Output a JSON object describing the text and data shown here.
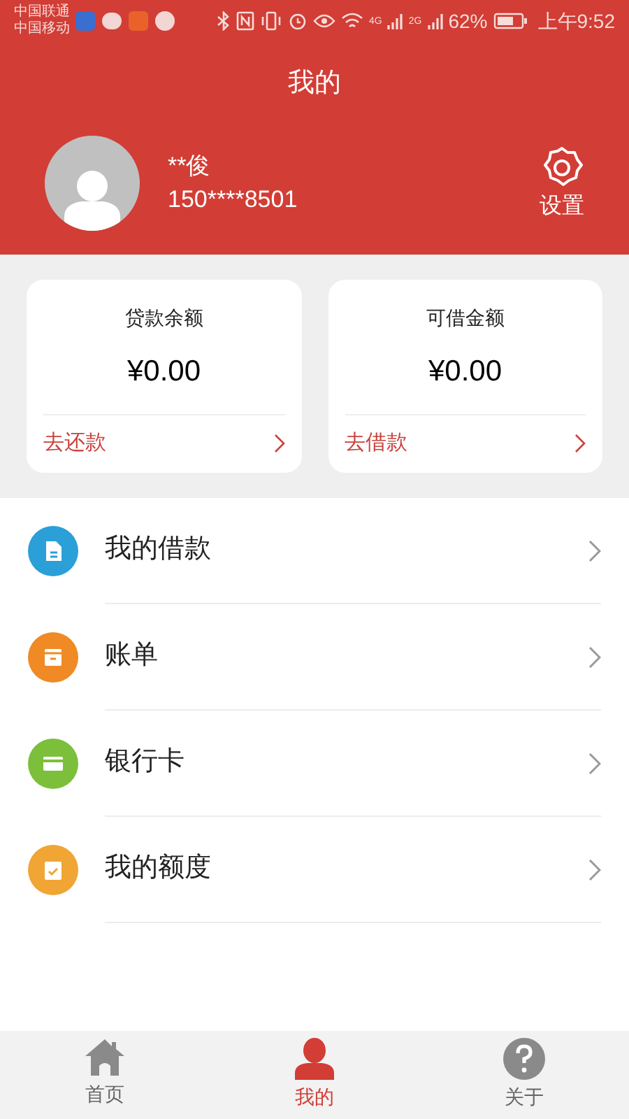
{
  "status_bar": {
    "carriers": [
      "中国联通",
      "中国移动"
    ],
    "network_1": "4G",
    "network_2": "2G",
    "battery_percent": "62%",
    "time": "上午9:52"
  },
  "header": {
    "title": "我的"
  },
  "profile": {
    "name": "**俊",
    "phone": "150****8501",
    "settings_label": "设置"
  },
  "cards": [
    {
      "title": "贷款余额",
      "amount": "¥0.00",
      "action": "去还款"
    },
    {
      "title": "可借金额",
      "amount": "¥0.00",
      "action": "去借款"
    }
  ],
  "menu": [
    {
      "label": "我的借款",
      "kind": "document",
      "color": "#2a9fd8"
    },
    {
      "label": "账单",
      "kind": "box",
      "color": "#f08a24"
    },
    {
      "label": "银行卡",
      "kind": "card",
      "color": "#7bbf3a"
    },
    {
      "label": "我的额度",
      "kind": "clipboard",
      "color": "#f0a534"
    }
  ],
  "bottom_nav": [
    {
      "label": "首页",
      "kind": "home",
      "selected": false
    },
    {
      "label": "我的",
      "kind": "person",
      "selected": true
    },
    {
      "label": "关于",
      "kind": "help",
      "selected": false
    }
  ]
}
